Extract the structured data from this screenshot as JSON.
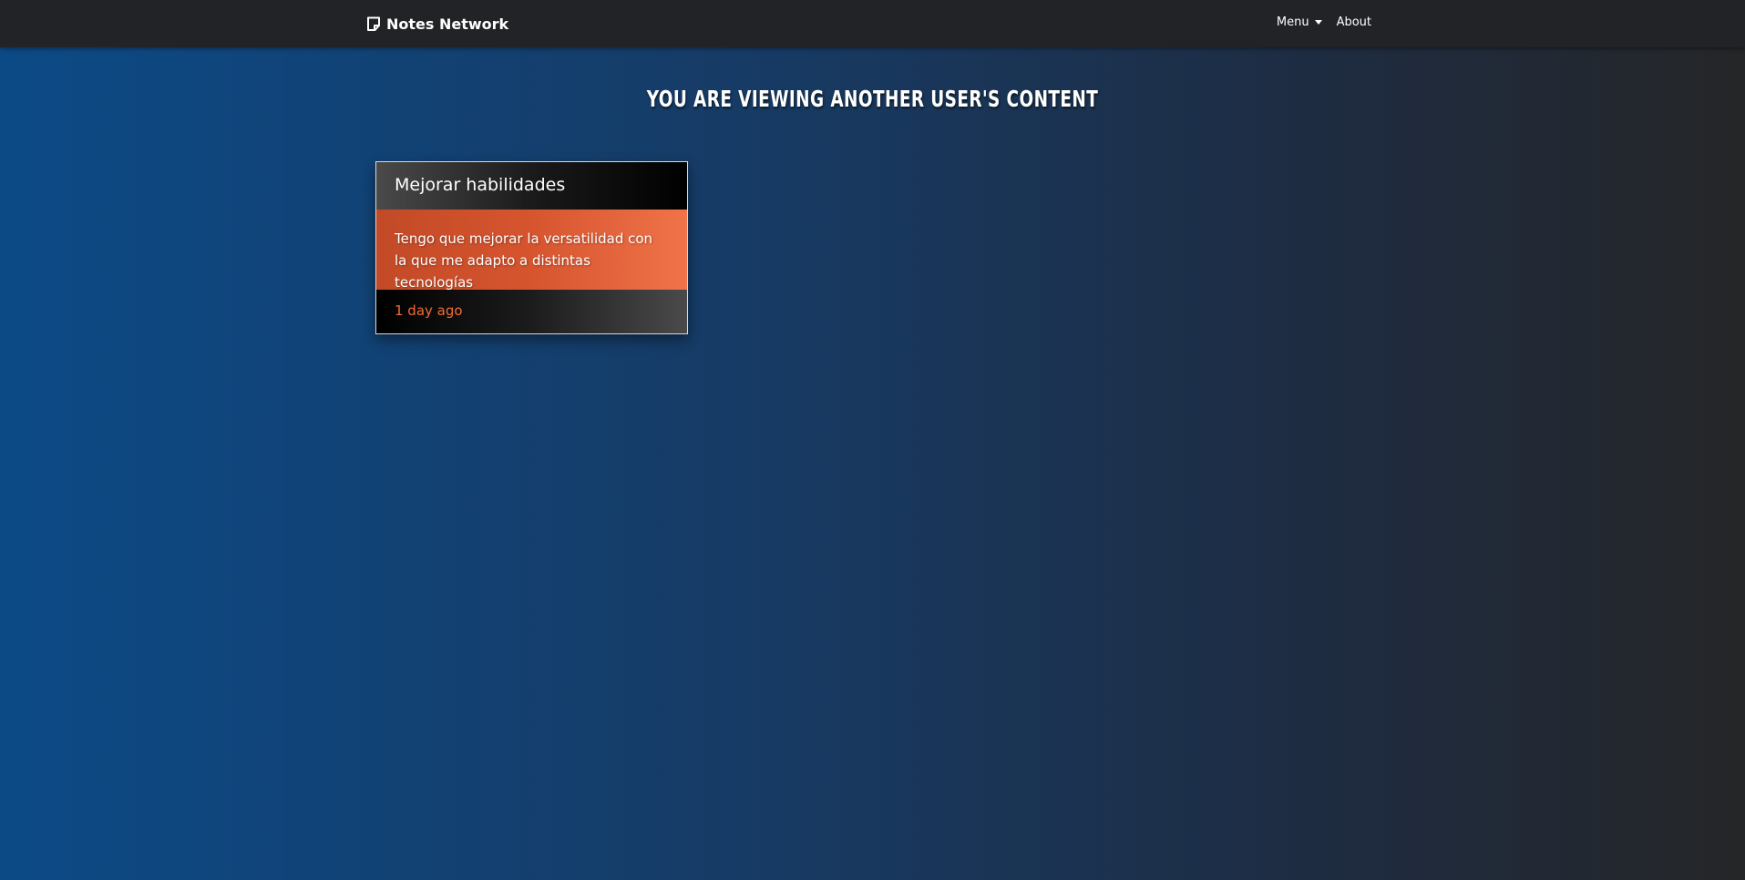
{
  "navbar": {
    "brand_label": "Notes Network",
    "brand_icon": "sticky-note-icon",
    "menu_label": "Menu",
    "about_label": "About"
  },
  "page": {
    "title": "You are viewing another user's content"
  },
  "notes": [
    {
      "title": "Mejorar habilidades",
      "body": "Tengo que mejorar la versatilidad con la que me adapto a distintas tecnologías",
      "timestamp": "1 day ago"
    }
  ],
  "colors": {
    "navbar_bg": "#222326",
    "accent_orange": "#f26b35",
    "background_blue": "#0c4a86"
  }
}
